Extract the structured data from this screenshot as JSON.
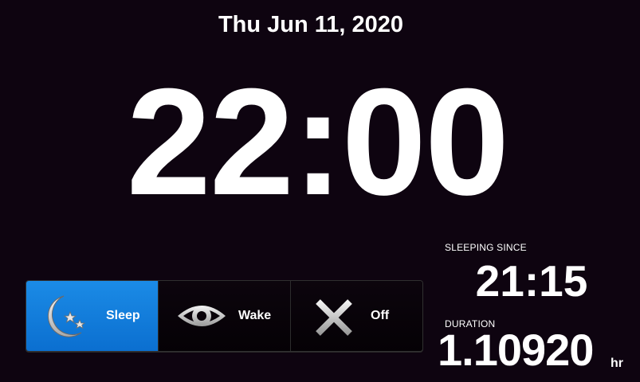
{
  "header": {
    "date": "Thu Jun 11, 2020"
  },
  "clock": {
    "time": "22:00"
  },
  "modes": {
    "active": "sleep",
    "accent_color": "#1a86e3",
    "items": [
      {
        "id": "sleep",
        "label": "Sleep",
        "icon": "moon-stars-icon"
      },
      {
        "id": "wake",
        "label": "Wake",
        "icon": "eye-icon"
      },
      {
        "id": "off",
        "label": "Off",
        "icon": "x-icon"
      }
    ]
  },
  "status": {
    "since_label": "SLEEPING SINCE",
    "since_value": "21:15",
    "duration_label": "DURATION",
    "duration_value": "1.10920",
    "duration_unit": "hr"
  }
}
